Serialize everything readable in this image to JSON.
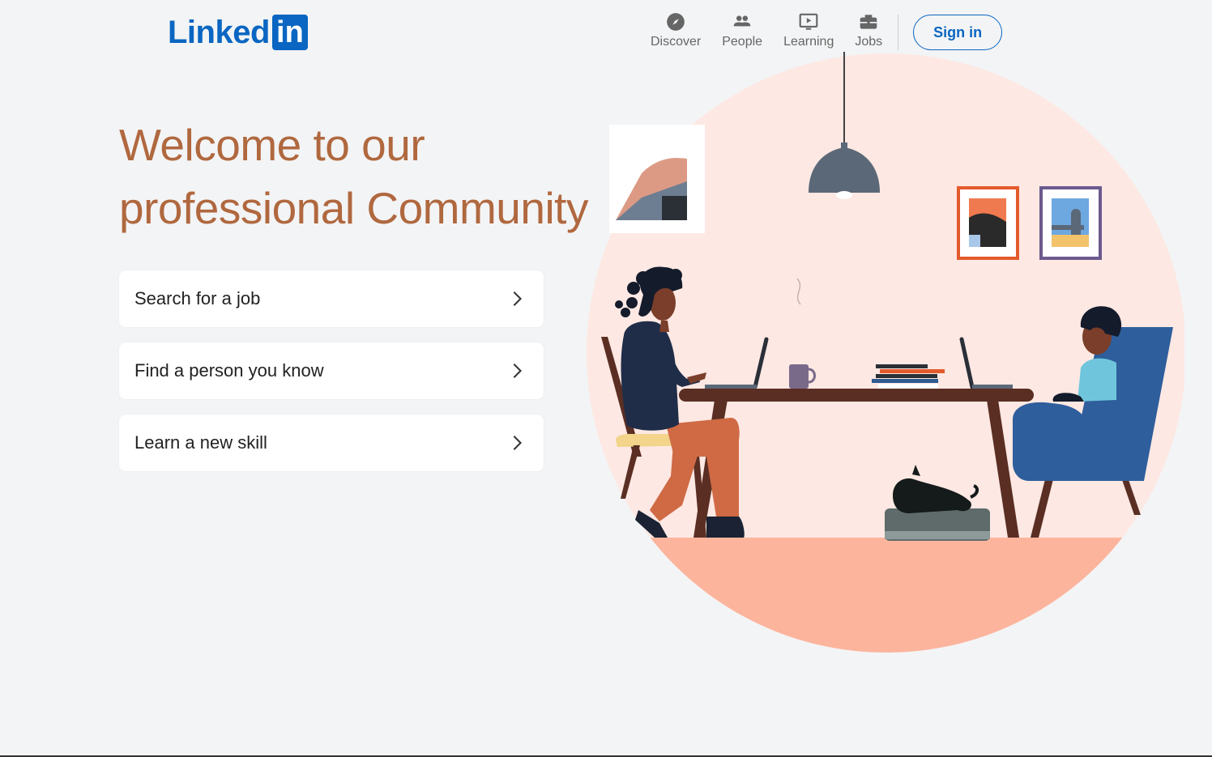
{
  "brand": {
    "logo_text": "Linked",
    "logo_box_text": "in",
    "color": "#0a66c2"
  },
  "nav": {
    "items": [
      {
        "label": "Discover",
        "icon": "compass-icon"
      },
      {
        "label": "People",
        "icon": "people-icon"
      },
      {
        "label": "Learning",
        "icon": "play-screen-icon"
      },
      {
        "label": "Jobs",
        "icon": "briefcase-icon"
      }
    ],
    "signin_label": "Sign in"
  },
  "hero": {
    "title": "Welcome to our professional Community",
    "title_color": "#b0683f"
  },
  "actions": [
    {
      "label": "Search for a job",
      "icon": "chevron-right-icon"
    },
    {
      "label": "Find a person you know",
      "icon": "chevron-right-icon"
    },
    {
      "label": "Learn a new skill",
      "icon": "chevron-right-icon"
    }
  ],
  "illustration": {
    "circle_color": "#fde8e3",
    "floor_color": "#fcb49d"
  }
}
